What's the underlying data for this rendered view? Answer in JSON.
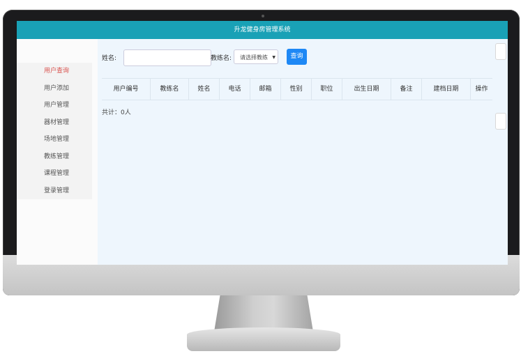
{
  "app_title": "升龙健身房管理系统",
  "sidebar": {
    "items": [
      {
        "label": "用户查询",
        "active": true
      },
      {
        "label": "用户添加",
        "active": false
      },
      {
        "label": "用户管理",
        "active": false
      },
      {
        "label": "器材管理",
        "active": false
      },
      {
        "label": "场地管理",
        "active": false
      },
      {
        "label": "教练管理",
        "active": false
      },
      {
        "label": "课程管理",
        "active": false
      },
      {
        "label": "登录管理",
        "active": false
      }
    ]
  },
  "search": {
    "name_label": "姓名:",
    "name_value": "",
    "coach_label": "教练名:",
    "coach_select_value": "请选择教练",
    "query_button": "查询"
  },
  "table": {
    "headers": [
      "用户编号",
      "教练名",
      "姓名",
      "电话",
      "邮箱",
      "性别",
      "职位",
      "出生日期",
      "备注",
      "建档日期",
      "操作"
    ],
    "rows": []
  },
  "total_text": "共计：0人",
  "colors": {
    "header_bar": "#19a1b6",
    "active_menu": "#d9534f",
    "primary_button": "#1e88f5",
    "main_bg": "#eef6fd"
  }
}
